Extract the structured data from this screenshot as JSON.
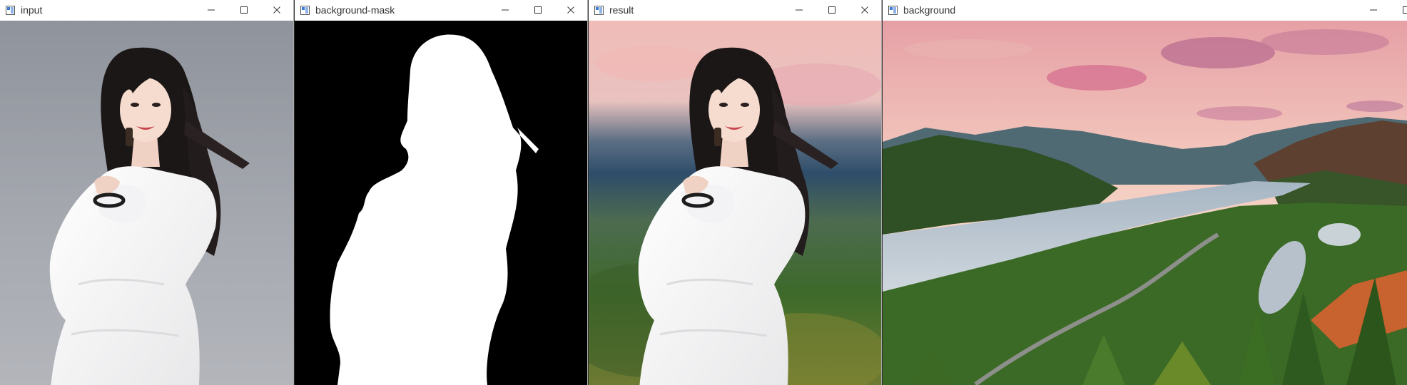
{
  "windows": [
    {
      "title": "input"
    },
    {
      "title": "background-mask"
    },
    {
      "title": "result"
    },
    {
      "title": "background"
    }
  ],
  "icons": {
    "app": "opencv-window-icon",
    "minimize": "minimize-icon",
    "maximize": "maximize-icon",
    "close": "close-icon"
  },
  "colors": {
    "titlebar_bg": "#ffffff",
    "title_text": "#333333",
    "mask_background": "#000000",
    "mask_foreground": "#ffffff",
    "input_backdrop": "#9ea1a8",
    "sky_pink": "#e8a2a8",
    "river": "#b9c4cf",
    "forest": "#2f5a22"
  }
}
